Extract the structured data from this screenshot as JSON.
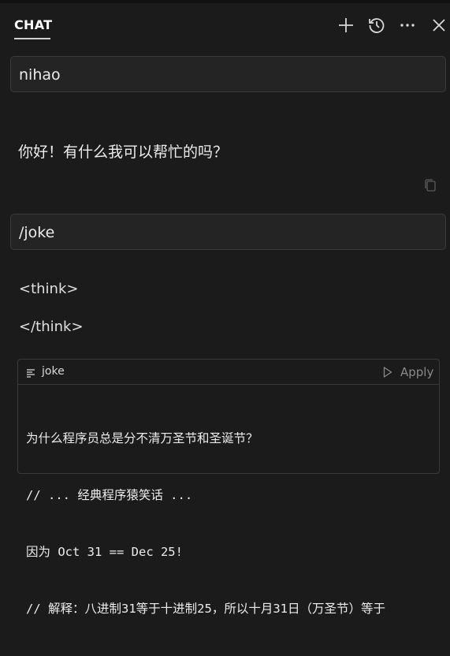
{
  "header": {
    "tab_label": "CHAT",
    "icons": [
      "plus-icon",
      "history-icon",
      "more-icon",
      "close-icon"
    ]
  },
  "messages": [
    {
      "role": "user",
      "text": "nihao"
    },
    {
      "role": "assistant",
      "text": "你好！有什么我可以帮忙的吗？"
    },
    {
      "role": "user",
      "text": "/joke"
    }
  ],
  "response": {
    "think_open": "<think>",
    "think_close": "</think>"
  },
  "code_block": {
    "language": "joke",
    "apply_label": "Apply",
    "lines": [
      "为什么程序员总是分不清万圣节和圣诞节？",
      "// ... 经典程序猿笑话 ...",
      "因为 Oct 31 == Dec 25!",
      "// 解释：八进制31等于十进制25，所以十月31日（万圣节）等于"
    ]
  },
  "colors": {
    "background": "#1b1b1b",
    "input_background": "#242424",
    "border": "#3b3b3b",
    "text": "#ececec",
    "muted": "#8a8a8a"
  }
}
